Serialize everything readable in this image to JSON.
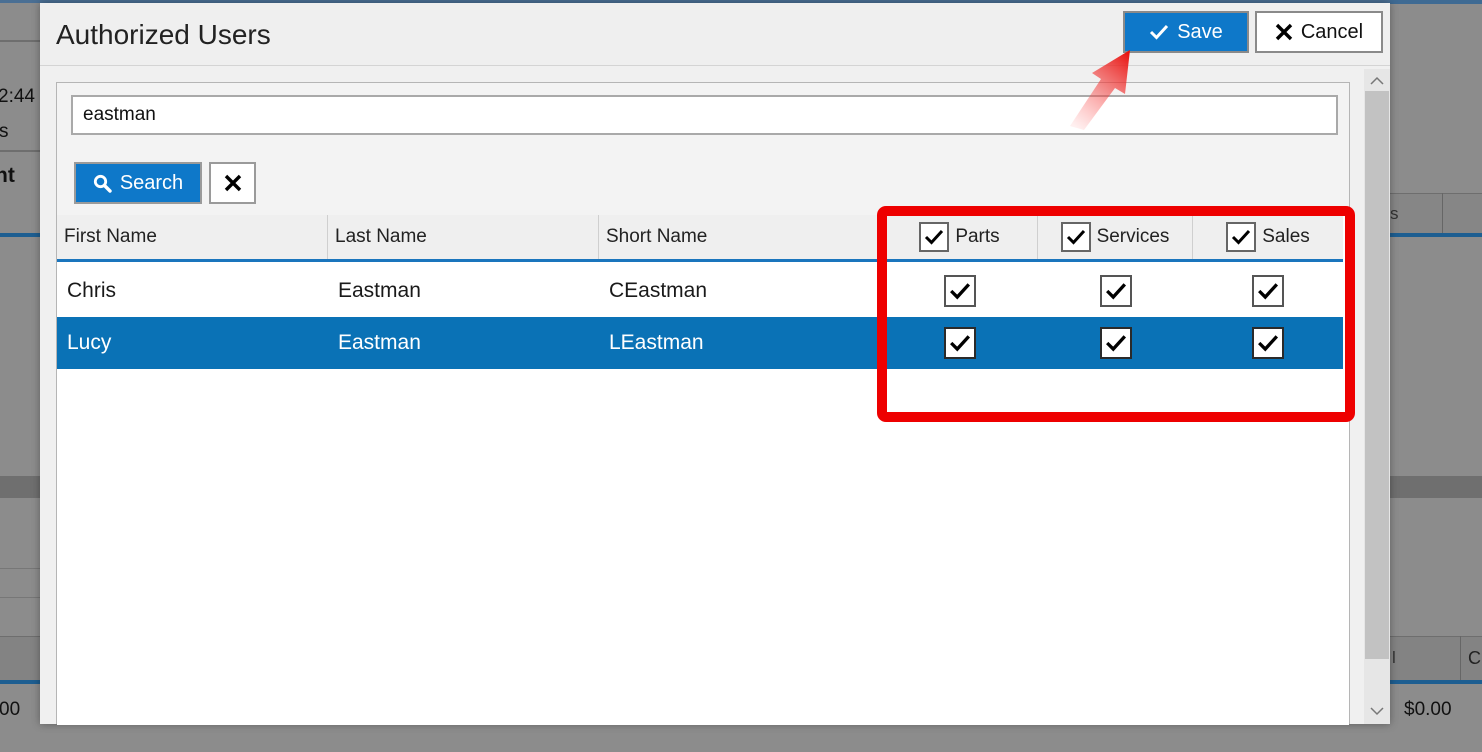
{
  "background_app": {
    "frag_time": "2:44 /",
    "frag_s": "s",
    "frag_bold": "nt",
    "frag_col1": "s",
    "frag_col2": "l",
    "frag_col3": "C",
    "frag_money_left": "00",
    "frag_money_right": "$0.00"
  },
  "dialog": {
    "title": "Authorized Users",
    "save_label": "Save",
    "cancel_label": "Cancel"
  },
  "search": {
    "value": "eastman",
    "button_label": "Search"
  },
  "grid": {
    "columns": {
      "first_name": "First Name",
      "last_name": "Last Name",
      "short_name": "Short Name",
      "parts": "Parts",
      "services": "Services",
      "sales": "Sales"
    },
    "header_checks": {
      "parts": true,
      "services": true,
      "sales": true
    },
    "rows": [
      {
        "first_name": "Chris",
        "last_name": "Eastman",
        "short_name": "CEastman",
        "parts": true,
        "services": true,
        "sales": true,
        "selected": false
      },
      {
        "first_name": "Lucy",
        "last_name": "Eastman",
        "short_name": "LEastman",
        "parts": true,
        "services": true,
        "sales": true,
        "selected": true
      }
    ]
  },
  "icons": {
    "save": "check-icon",
    "cancel": "x-icon",
    "search": "magnifier-icon",
    "clear": "x-icon",
    "checkbox": "checkmark-icon"
  },
  "colors": {
    "accent": "#0e78c9",
    "selected_row": "#0a72b6",
    "annotation": "#ee0000"
  }
}
